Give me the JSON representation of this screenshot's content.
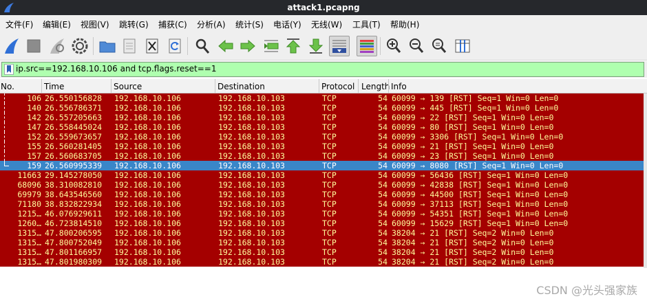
{
  "window": {
    "title": "attack1.pcapng"
  },
  "menu": [
    "文件(F)",
    "编辑(E)",
    "视图(V)",
    "跳转(G)",
    "捕获(C)",
    "分析(A)",
    "统计(S)",
    "电话(Y)",
    "无线(W)",
    "工具(T)",
    "帮助(H)"
  ],
  "toolbar": {
    "icons": [
      "shark-fin-start-icon",
      "stop-square-icon",
      "restart-fin-icon",
      "capture-options-gear-icon",
      "open-folder-icon",
      "file-icon",
      "close-file-icon",
      "reload-icon",
      "search-icon",
      "go-back-arrow-icon",
      "go-forward-arrow-icon",
      "go-to-packet-icon",
      "first-packet-icon",
      "last-packet-icon",
      "autoscroll-icon",
      "colorize-icon",
      "zoom-in-icon",
      "zoom-out-icon",
      "normal-size-icon",
      "resize-columns-icon"
    ]
  },
  "filter": {
    "value": "ip.src==192.168.10.106 and tcp.flags.reset==1"
  },
  "columns": [
    "No.",
    "Time",
    "Source",
    "Destination",
    "Protocol",
    "Length",
    "Info"
  ],
  "packets": [
    {
      "no": "106",
      "time": "26.550156828",
      "src": "192.168.10.106",
      "dst": "192.168.10.103",
      "proto": "TCP",
      "len": "54",
      "info": "60099 → 139 [RST] Seq=1 Win=0 Len=0",
      "tree": "line"
    },
    {
      "no": "140",
      "time": "26.556786371",
      "src": "192.168.10.106",
      "dst": "192.168.10.103",
      "proto": "TCP",
      "len": "54",
      "info": "60099 → 445 [RST] Seq=1 Win=0 Len=0",
      "tree": "line"
    },
    {
      "no": "142",
      "time": "26.557205663",
      "src": "192.168.10.106",
      "dst": "192.168.10.103",
      "proto": "TCP",
      "len": "54",
      "info": "60099 → 22 [RST] Seq=1 Win=0 Len=0",
      "tree": "line"
    },
    {
      "no": "147",
      "time": "26.558445024",
      "src": "192.168.10.106",
      "dst": "192.168.10.103",
      "proto": "TCP",
      "len": "54",
      "info": "60099 → 80 [RST] Seq=1 Win=0 Len=0",
      "tree": "line"
    },
    {
      "no": "152",
      "time": "26.559673657",
      "src": "192.168.10.106",
      "dst": "192.168.10.103",
      "proto": "TCP",
      "len": "54",
      "info": "60099 → 3306 [RST] Seq=1 Win=0 Len=0",
      "tree": "line"
    },
    {
      "no": "155",
      "time": "26.560281405",
      "src": "192.168.10.106",
      "dst": "192.168.10.103",
      "proto": "TCP",
      "len": "54",
      "info": "60099 → 21 [RST] Seq=1 Win=0 Len=0",
      "tree": "line"
    },
    {
      "no": "157",
      "time": "26.560683705",
      "src": "192.168.10.106",
      "dst": "192.168.10.103",
      "proto": "TCP",
      "len": "54",
      "info": "60099 → 23 [RST] Seq=1 Win=0 Len=0",
      "tree": "line"
    },
    {
      "no": "159",
      "time": "26.560995339",
      "src": "192.168.10.106",
      "dst": "192.168.10.103",
      "proto": "TCP",
      "len": "54",
      "info": "60099 → 8080 [RST] Seq=1 Win=0 Len=0",
      "tree": "end",
      "selected": true
    },
    {
      "no": "11663",
      "time": "29.145278050",
      "src": "192.168.10.106",
      "dst": "192.168.10.103",
      "proto": "TCP",
      "len": "54",
      "info": "60099 → 56436 [RST] Seq=1 Win=0 Len=0"
    },
    {
      "no": "68096",
      "time": "38.310082810",
      "src": "192.168.10.106",
      "dst": "192.168.10.103",
      "proto": "TCP",
      "len": "54",
      "info": "60099 → 42838 [RST] Seq=1 Win=0 Len=0"
    },
    {
      "no": "69979",
      "time": "38.643546560",
      "src": "192.168.10.106",
      "dst": "192.168.10.103",
      "proto": "TCP",
      "len": "54",
      "info": "60099 → 44500 [RST] Seq=1 Win=0 Len=0"
    },
    {
      "no": "71180",
      "time": "38.832822934",
      "src": "192.168.10.106",
      "dst": "192.168.10.103",
      "proto": "TCP",
      "len": "54",
      "info": "60099 → 37113 [RST] Seq=1 Win=0 Len=0"
    },
    {
      "no": "1215…",
      "time": "46.076929611",
      "src": "192.168.10.106",
      "dst": "192.168.10.103",
      "proto": "TCP",
      "len": "54",
      "info": "60099 → 54351 [RST] Seq=1 Win=0 Len=0"
    },
    {
      "no": "1260…",
      "time": "46.723814510",
      "src": "192.168.10.106",
      "dst": "192.168.10.103",
      "proto": "TCP",
      "len": "54",
      "info": "60099 → 15629 [RST] Seq=1 Win=0 Len=0"
    },
    {
      "no": "1315…",
      "time": "47.800206595",
      "src": "192.168.10.106",
      "dst": "192.168.10.103",
      "proto": "TCP",
      "len": "54",
      "info": "38204 → 21 [RST] Seq=2 Win=0 Len=0"
    },
    {
      "no": "1315…",
      "time": "47.800752049",
      "src": "192.168.10.106",
      "dst": "192.168.10.103",
      "proto": "TCP",
      "len": "54",
      "info": "38204 → 21 [RST] Seq=2 Win=0 Len=0"
    },
    {
      "no": "1315…",
      "time": "47.801166957",
      "src": "192.168.10.106",
      "dst": "192.168.10.103",
      "proto": "TCP",
      "len": "54",
      "info": "38204 → 21 [RST] Seq=2 Win=0 Len=0"
    },
    {
      "no": "1315…",
      "time": "47.801980309",
      "src": "192.168.10.106",
      "dst": "192.168.10.103",
      "proto": "TCP",
      "len": "54",
      "info": "38204 → 21 [RST] Seq=2 Win=0 Len=0"
    }
  ],
  "colors": {
    "row_bg": "#a40000",
    "row_fg": "#fffc9c",
    "selected_bg": "#3a86c8",
    "filter_bg": "#afffaf"
  },
  "watermark": "CSDN @光头强家族"
}
